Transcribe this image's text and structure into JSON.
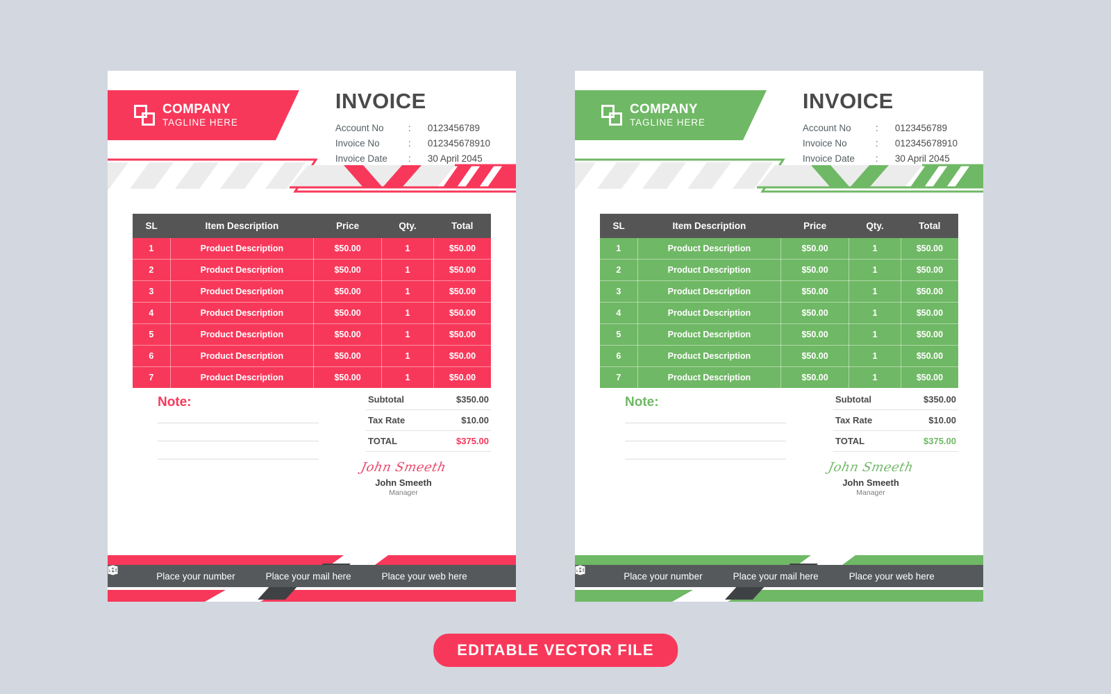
{
  "background_color": "#d3d7e0",
  "variants": [
    {
      "id": "red",
      "accent": "#f8385a",
      "name": "red-invoice"
    },
    {
      "id": "green",
      "accent": "#6fb865",
      "name": "green-invoice"
    }
  ],
  "brand": {
    "name": "COMPANY",
    "tagline": "TAGLINE HERE",
    "logo_icon": "overlapping-squares-icon"
  },
  "header": {
    "title": "INVOICE",
    "fields": [
      {
        "label": "Account No",
        "sep": ":",
        "value": "0123456789"
      },
      {
        "label": "Invoice No",
        "sep": ":",
        "value": "012345678910"
      },
      {
        "label": "Invoice Date",
        "sep": ":",
        "value": "30 April 2045"
      }
    ]
  },
  "table": {
    "columns": [
      "SL",
      "Item Description",
      "Price",
      "Qty.",
      "Total"
    ],
    "rows": [
      [
        "1",
        "Product Description",
        "$50.00",
        "1",
        "$50.00"
      ],
      [
        "2",
        "Product Description",
        "$50.00",
        "1",
        "$50.00"
      ],
      [
        "3",
        "Product Description",
        "$50.00",
        "1",
        "$50.00"
      ],
      [
        "4",
        "Product Description",
        "$50.00",
        "1",
        "$50.00"
      ],
      [
        "5",
        "Product Description",
        "$50.00",
        "1",
        "$50.00"
      ],
      [
        "6",
        "Product Description",
        "$50.00",
        "1",
        "$50.00"
      ],
      [
        "7",
        "Product Description",
        "$50.00",
        "1",
        "$50.00"
      ]
    ]
  },
  "totals": [
    {
      "label": "Subtotal",
      "value": "$350.00",
      "grand": false
    },
    {
      "label": "Tax Rate",
      "value": "$10.00",
      "grand": false
    },
    {
      "label": "TOTAL",
      "value": "$375.00",
      "grand": true
    }
  ],
  "note": {
    "title": "Note:",
    "lines": 3
  },
  "signature": {
    "script": "John Smeeth",
    "name": "John Smeeth",
    "role": "Manager"
  },
  "footer": {
    "items": [
      {
        "icon": "phone-icon",
        "label": "Place your number"
      },
      {
        "icon": "mail-icon",
        "label": "Place your mail here"
      },
      {
        "icon": "globe-icon",
        "label": "Place your web here"
      }
    ]
  },
  "banner": {
    "label": "EDITABLE VECTOR  FILE",
    "color": "#f8385a"
  }
}
